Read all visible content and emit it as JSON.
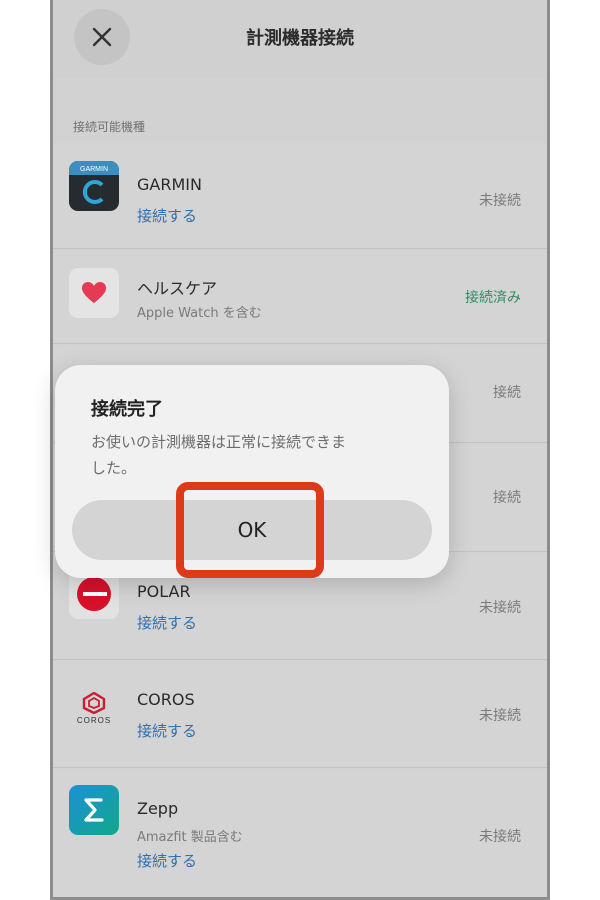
{
  "header": {
    "title": "計測機器接続",
    "close_icon": "close-icon"
  },
  "section": {
    "label": "接続可能機種"
  },
  "devices": [
    {
      "name": "GARMIN",
      "sub": "",
      "link": "接続する",
      "status": "未接続"
    },
    {
      "name": "ヘルスケア",
      "sub": "Apple Watch を含む",
      "link": "",
      "status": "接続済み"
    },
    {
      "name": "",
      "sub": "",
      "link": "",
      "status": "接続"
    },
    {
      "name": "",
      "sub": "",
      "link": "",
      "status": "接続"
    },
    {
      "name": "POLAR",
      "sub": "",
      "link": "接続する",
      "status": "未接続"
    },
    {
      "name": "COROS",
      "sub": "",
      "link": "接続する",
      "status": "未接続",
      "logo_text": "COROS"
    },
    {
      "name": "Zepp",
      "sub": "Amazfit 製品含む",
      "link": "接続する",
      "status": "未接続"
    }
  ],
  "dialog": {
    "title": "接続完了",
    "message": "お使いの計測機器は正常に接続できました。",
    "ok_label": "OK"
  },
  "colors": {
    "link": "#2e6fb0",
    "connected": "#2f8c63",
    "highlight": "#dd3a1a"
  }
}
